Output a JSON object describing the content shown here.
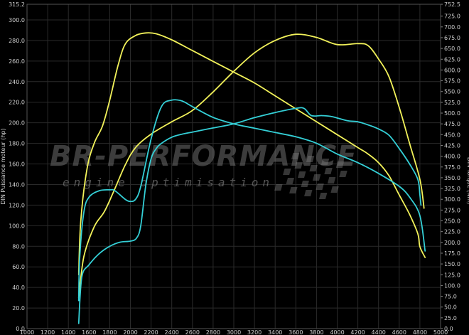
{
  "chart_data": {
    "type": "line",
    "xlabel": "",
    "ylabel_left": "DIN Puissance moteur (hp)",
    "ylabel_right": "DIN Torque (Nm)",
    "xlim": [
      1000,
      5000
    ],
    "ylim_left": [
      0,
      315.2
    ],
    "ylim_right": [
      0,
      752.5
    ],
    "x_ticks": [
      "1000",
      "1200",
      "1400",
      "1600",
      "1800",
      "2000",
      "2200",
      "2400",
      "2600",
      "2800",
      "3000",
      "3200",
      "3400",
      "3600",
      "3800",
      "4000",
      "4200",
      "4400",
      "4600",
      "4800",
      "5000"
    ],
    "y_left_ticks": [
      "0.0",
      "20.0",
      "40.0",
      "60.0",
      "80.0",
      "100.0",
      "120.0",
      "140.0",
      "160.0",
      "180.0",
      "200.0",
      "220.0",
      "240.0",
      "260.0",
      "280.0",
      "300.0",
      "315.2"
    ],
    "y_right_ticks": [
      "0.0",
      "25.0",
      "50.0",
      "75.0",
      "100.0",
      "125.0",
      "150.0",
      "175.0",
      "200.0",
      "225.0",
      "250.0",
      "275.0",
      "300.0",
      "325.0",
      "350.0",
      "375.0",
      "400.0",
      "425.0",
      "450.0",
      "475.0",
      "500.0",
      "525.0",
      "550.0",
      "575.0",
      "600.0",
      "625.0",
      "650.0",
      "675.0",
      "700.0",
      "725.0",
      "752.5"
    ],
    "grid": true,
    "series": [
      {
        "axis": "left",
        "color": "#f2f25a",
        "points": [
          [
            1500,
            30
          ],
          [
            1550,
            70
          ],
          [
            1650,
            99
          ],
          [
            1750,
            114
          ],
          [
            1850,
            136
          ],
          [
            1950,
            159
          ],
          [
            2050,
            176
          ],
          [
            2200,
            189
          ],
          [
            2400,
            201
          ],
          [
            2600,
            212
          ],
          [
            2800,
            230
          ],
          [
            3000,
            250
          ],
          [
            3200,
            268
          ],
          [
            3400,
            280
          ],
          [
            3600,
            286
          ],
          [
            3800,
            283
          ],
          [
            4000,
            276
          ],
          [
            4200,
            277
          ],
          [
            4300,
            275
          ],
          [
            4400,
            262
          ],
          [
            4500,
            245
          ],
          [
            4600,
            215
          ],
          [
            4700,
            180
          ],
          [
            4800,
            145
          ],
          [
            4840,
            117
          ]
        ]
      },
      {
        "axis": "right",
        "color": "#f2f25a",
        "points": [
          [
            1500,
            125
          ],
          [
            1520,
            250
          ],
          [
            1580,
            370
          ],
          [
            1650,
            430
          ],
          [
            1730,
            470
          ],
          [
            1800,
            530
          ],
          [
            1880,
            610
          ],
          [
            1950,
            660
          ],
          [
            2050,
            680
          ],
          [
            2150,
            686
          ],
          [
            2250,
            684
          ],
          [
            2400,
            670
          ],
          [
            2600,
            645
          ],
          [
            2800,
            620
          ],
          [
            3000,
            595
          ],
          [
            3200,
            570
          ],
          [
            3400,
            540
          ],
          [
            3600,
            510
          ],
          [
            3800,
            480
          ],
          [
            4000,
            450
          ],
          [
            4200,
            420
          ],
          [
            4300,
            405
          ],
          [
            4400,
            385
          ],
          [
            4500,
            355
          ],
          [
            4600,
            310
          ],
          [
            4700,
            265
          ],
          [
            4780,
            220
          ],
          [
            4800,
            190
          ],
          [
            4850,
            165
          ]
        ]
      },
      {
        "axis": "left",
        "color": "#34cfd6",
        "points": [
          [
            1500,
            5
          ],
          [
            1530,
            50
          ],
          [
            1600,
            62
          ],
          [
            1700,
            73
          ],
          [
            1800,
            80
          ],
          [
            1900,
            84
          ],
          [
            2000,
            85
          ],
          [
            2060,
            88
          ],
          [
            2100,
            100
          ],
          [
            2150,
            140
          ],
          [
            2200,
            165
          ],
          [
            2250,
            175
          ],
          [
            2300,
            180
          ],
          [
            2400,
            186
          ],
          [
            2500,
            189
          ],
          [
            2600,
            191
          ],
          [
            2800,
            195
          ],
          [
            3000,
            199
          ],
          [
            3200,
            205
          ],
          [
            3400,
            210
          ],
          [
            3600,
            214
          ],
          [
            3680,
            214
          ],
          [
            3750,
            207
          ],
          [
            3850,
            207
          ],
          [
            3950,
            206
          ],
          [
            4100,
            202
          ],
          [
            4200,
            201
          ],
          [
            4300,
            198
          ],
          [
            4400,
            194
          ],
          [
            4500,
            188
          ],
          [
            4600,
            175
          ],
          [
            4700,
            160
          ],
          [
            4780,
            145
          ],
          [
            4800,
            130
          ],
          [
            4810,
            120
          ]
        ]
      },
      {
        "axis": "right",
        "color": "#34cfd6",
        "points": [
          [
            1500,
            65
          ],
          [
            1510,
            165
          ],
          [
            1550,
            270
          ],
          [
            1600,
            305
          ],
          [
            1700,
            320
          ],
          [
            1800,
            322
          ],
          [
            1850,
            320
          ],
          [
            1950,
            300
          ],
          [
            2000,
            295
          ],
          [
            2050,
            300
          ],
          [
            2100,
            330
          ],
          [
            2200,
            440
          ],
          [
            2300,
            515
          ],
          [
            2400,
            530
          ],
          [
            2500,
            528
          ],
          [
            2600,
            515
          ],
          [
            2800,
            490
          ],
          [
            3000,
            475
          ],
          [
            3200,
            465
          ],
          [
            3400,
            455
          ],
          [
            3600,
            445
          ],
          [
            3800,
            430
          ],
          [
            4000,
            405
          ],
          [
            4200,
            385
          ],
          [
            4400,
            360
          ],
          [
            4600,
            330
          ],
          [
            4700,
            305
          ],
          [
            4800,
            262
          ],
          [
            4850,
            180
          ]
        ]
      }
    ]
  },
  "watermark": {
    "title": "BR-PERFORMANCE",
    "subtitle": "engine optimisation"
  },
  "colors": {
    "background": "#000000",
    "grid": "#2a2a2a",
    "power_curve": "#f2f25a",
    "torque_curve": "#34cfd6"
  }
}
